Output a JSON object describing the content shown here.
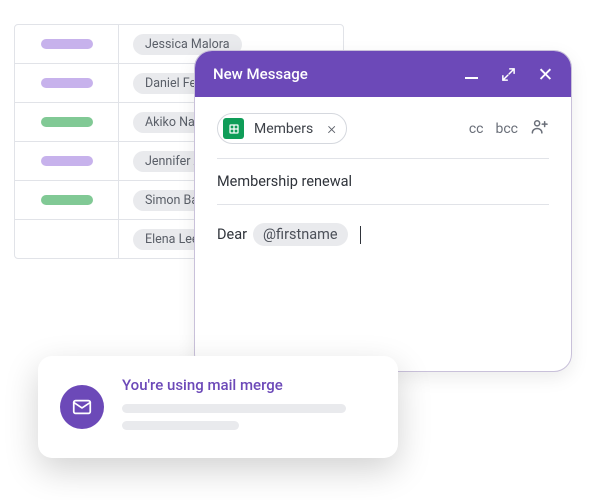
{
  "contacts": {
    "rows": [
      {
        "color": "purple",
        "name": "Jessica Malora"
      },
      {
        "color": "purple",
        "name": "Daniel Ferr"
      },
      {
        "color": "green",
        "name": "Akiko Naka"
      },
      {
        "color": "purple",
        "name": "Jennifer Ac"
      },
      {
        "color": "green",
        "name": "Simon Balli"
      },
      {
        "color": "",
        "name": "Elena Lee"
      }
    ]
  },
  "composer": {
    "title": "New Message",
    "to_chip": "Members",
    "chip_remove": "×",
    "cc": "cc",
    "bcc": "bcc",
    "subject": "Membership renewal",
    "greeting": "Dear",
    "mention": "@firstname"
  },
  "popup": {
    "title": "You're using mail merge"
  }
}
